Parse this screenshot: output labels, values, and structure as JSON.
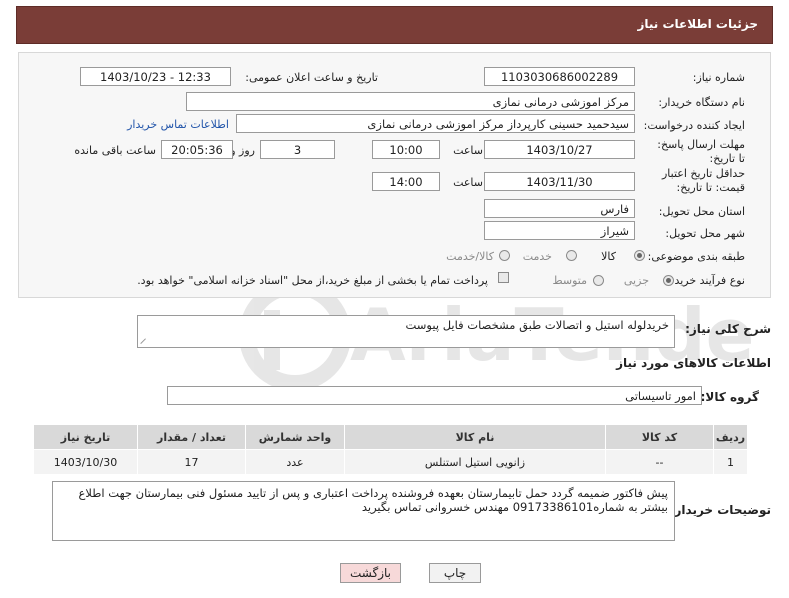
{
  "header": {
    "title": "جزئیات اطلاعات نیاز"
  },
  "form": {
    "need_number_label": "شماره نیاز:",
    "need_number": "1103030686002289",
    "announce_label": "تاریخ و ساعت اعلان عمومی:",
    "announce_value": "1403/10/23 - 12:33",
    "buyer_org_label": "نام دستگاه خریدار:",
    "buyer_org": "مرکز اموزشی درمانی نمازی",
    "creator_label": "ایجاد کننده درخواست:",
    "creator": "سیدحمید حسینی کارپرداز مرکز اموزشی درمانی نمازی",
    "contact_link": "اطلاعات تماس خریدار",
    "deadline_label": "مهلت ارسال پاسخ: تا تاریخ:",
    "deadline_date": "1403/10/27",
    "time_label": "ساعت",
    "deadline_time": "10:00",
    "days_value": "3",
    "days_label": "روز و",
    "remaining_time": "20:05:36",
    "remaining_label": "ساعت باقی مانده",
    "price_validity_label": "حداقل تاریخ اعتبار قیمت: تا تاریخ:",
    "price_date": "1403/11/30",
    "price_time": "14:00",
    "province_label": "استان محل تحویل:",
    "province": "فارس",
    "city_label": "شهر محل تحویل:",
    "city": "شیراز",
    "category_label": "طبقه بندی موضوعی:",
    "category_options": [
      "کالا",
      "خدمت",
      "کالا/خدمت"
    ],
    "category_selected": "کالا",
    "purchase_type_label": "نوع فرآیند خرید :",
    "purchase_options": [
      "جزیی",
      "متوسط"
    ],
    "payment_note": "پرداخت تمام یا بخشی از مبلغ خرید،از محل \"اسناد خزانه اسلامی\" خواهد بود."
  },
  "description": {
    "label": "شرح کلی نیاز:",
    "value": "خریدلوله استیل و اتصالات طبق مشخصات فایل پیوست"
  },
  "goods": {
    "section_title": "اطلاعات کالاهای مورد نیاز",
    "group_label": "گروه کالا:",
    "group_value": "امور تاسیساتی",
    "columns": [
      "ردیف",
      "کد کالا",
      "نام کالا",
      "واحد شمارش",
      "تعداد / مقدار",
      "تاریخ نیاز"
    ],
    "rows": [
      {
        "index": "1",
        "code": "--",
        "name": "زانویی استیل استنلس",
        "unit": "عدد",
        "qty": "17",
        "date": "1403/10/30"
      }
    ]
  },
  "buyer_notes": {
    "label": "توضیحات خریدار:",
    "value": "پیش فاکتور ضمیمه گردد حمل تابیمارستان بعهده فروشنده پرداخت اعتباری و پس از تایید مسئول فنی بیمارستان جهت اطلاع بیشتر به شماره09173386101 مهندس خسروانی  تماس بگیرید"
  },
  "buttons": {
    "print": "چاپ",
    "back": "بازگشت"
  },
  "watermark": "AriaTender.neT",
  "colors": {
    "header": "#7a3d37",
    "link": "#2255aa",
    "back_button": "#f7d9d9"
  }
}
